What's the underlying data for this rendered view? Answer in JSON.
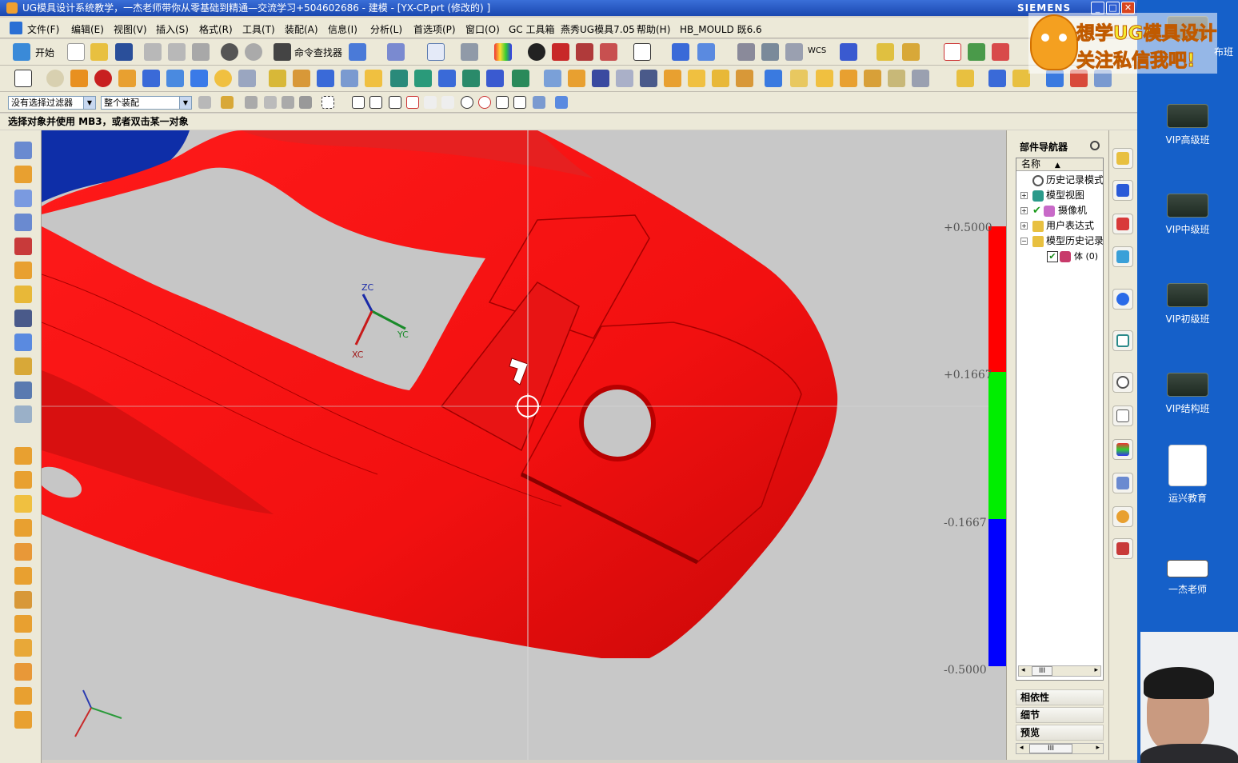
{
  "window": {
    "title": "UG模具设计系统教学，一杰老师带你从零基础到精通—交流学习+504602686 - 建模 - [YX-CP.prt (修改的) ]",
    "brand": "SIEMENS",
    "min": "_",
    "max": "□",
    "close": "✕"
  },
  "menu": [
    "文件(F)",
    "编辑(E)",
    "视图(V)",
    "插入(S)",
    "格式(R)",
    "工具(T)",
    "装配(A)",
    "信息(I)",
    "分析(L)",
    "首选项(P)",
    "窗口(O)",
    "GC 工具箱",
    "燕秀UG模具7.05",
    "帮助(H)",
    "HB_MOULD 既6.6"
  ],
  "toolbar": {
    "start_label": "开始",
    "command_finder": "命令查找器",
    "wcs_label": "WCS"
  },
  "filters": {
    "selection_filter": "没有选择过滤器",
    "assembly_scope": "整个装配"
  },
  "status": {
    "prompt": "选择对象并使用 MB3，或者双击某一对象"
  },
  "viewport": {
    "axes": {
      "zc": "ZC",
      "yc": "YC",
      "xc": "XC"
    },
    "scale_labels": [
      "+0.5000",
      "+0.1667",
      "-0.1667",
      "-0.5000"
    ],
    "scale_colors": [
      "#ff0000",
      "#00ee00",
      "#0000ff"
    ]
  },
  "part_navigator": {
    "title": "部件导航器",
    "column": "名称",
    "items": [
      {
        "label": "历史记录模式",
        "expander": "",
        "icon": "clock-icon",
        "indent": 1
      },
      {
        "label": "模型视图",
        "expander": "+",
        "icon": "model-view-icon",
        "indent": 1
      },
      {
        "label": "摄像机",
        "expander": "+",
        "icon": "camera-icon",
        "indent": 1,
        "checked": true
      },
      {
        "label": "用户表达式",
        "expander": "+",
        "icon": "folder-icon",
        "indent": 1
      },
      {
        "label": "模型历史记录",
        "expander": "−",
        "icon": "folder-icon",
        "indent": 1
      },
      {
        "label": "体 (0)",
        "expander": "",
        "icon": "body-icon",
        "indent": 2,
        "checked": true
      }
    ],
    "sections": [
      "相依性",
      "细节",
      "预览"
    ],
    "scroll_left": "◂",
    "scroll_right": "▸",
    "scroll_thumb": "III"
  },
  "desktop": {
    "icons": [
      {
        "label": "布班"
      },
      {
        "label": "VIP高级班"
      },
      {
        "label": "VIP中级班"
      },
      {
        "label": "VIP初级班"
      },
      {
        "label": "VIP结构班"
      },
      {
        "label": "运兴教育"
      },
      {
        "label": "一杰老师"
      }
    ],
    "overlay_lines": [
      "想学UG模具设计",
      "关注私信我吧!"
    ]
  }
}
